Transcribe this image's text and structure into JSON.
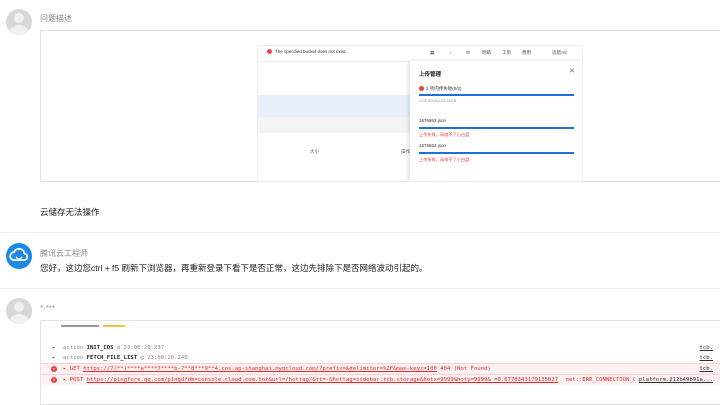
{
  "post1": {
    "label": "问题描述",
    "comment": "云储存无法操作"
  },
  "screenshot": {
    "error_toast": "The specified bucket does not exist.",
    "nav": [
      "明箱",
      "工单",
      "费用",
      "思腊AC"
    ],
    "col_labels": [
      "大小",
      "操作"
    ],
    "drawer": {
      "title": "上传管理",
      "close": "✕",
      "status": "2 项内传失败(0/2)",
      "size": "1/28.50KB/128.50KB",
      "files": [
        {
          "name": "1676863.json",
          "error": "上传失败，网络不了小白盘"
        },
        {
          "name": "1676863.json",
          "error": "上传失败，网络不了小白盘"
        }
      ]
    }
  },
  "post2": {
    "author": "腾讯云工程师",
    "text": "您好，这边您ctrl + f5 刷新下浏览器，再重新登录下看下是否正常，这边先排除下是否网络波动引起的。"
  },
  "post3": {
    "author": "*·***"
  },
  "console": {
    "lines": [
      {
        "prefix": "action",
        "key": "INIT_COS",
        "rest": "@ 23:00:20.237",
        "src": "tcb."
      },
      {
        "prefix": "action",
        "key": "FETCH_FILE_LIST",
        "rest": "@ 23:00:20.240",
        "src": "tcb."
      },
      {
        "prefix": "GET",
        "url": "https://7(**)****a****7****b-7**8***9**4.cos.ap-shanghai.myqcloud.com/?prefix=&delimiter=%2F&max-keys=100",
        "status": "404 (Not Found)",
        "src": "tcb."
      },
      {
        "prefix": "POST",
        "url": "https://pingfore.qq.com/pingd?dm=console.cloud.com.hot&url=/hottag/&tt=-&hottag=sidebar.tcb.storage&hotx=9999&hoty=9999&_=0.6778343179135027",
        "status": "net::ERR_CONNECTION_CLOSED",
        "src": "platform.212b49b91a..."
      }
    ]
  }
}
